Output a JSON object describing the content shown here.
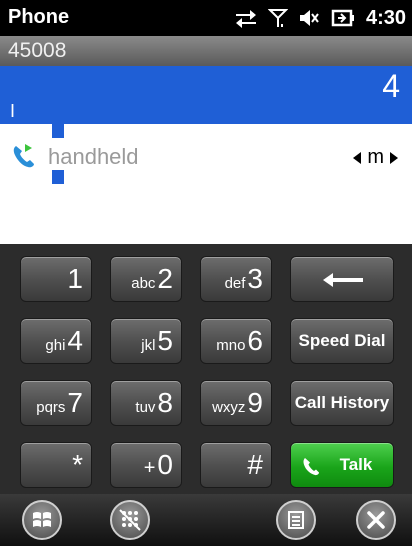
{
  "app_title": "Phone",
  "status": {
    "time": "4:30"
  },
  "carrier": "45008",
  "entry": {
    "number": "4",
    "cursor": "I"
  },
  "match": {
    "name": "handheld",
    "type": "m"
  },
  "keypad": {
    "k1": "1",
    "k2_letters": "abc",
    "k2": "2",
    "k3_letters": "def",
    "k3": "3",
    "k4_letters": "ghi",
    "k4": "4",
    "k5_letters": "jkl",
    "k5": "5",
    "k6_letters": "mno",
    "k6": "6",
    "k7_letters": "pqrs",
    "k7": "7",
    "k8_letters": "tuv",
    "k8": "8",
    "k9_letters": "wxyz",
    "k9": "9",
    "star": "*",
    "k0_prefix": "+",
    "k0": "0",
    "hash": "#",
    "speed_dial": "Speed Dial",
    "call_history": "Call History",
    "talk": "Talk"
  },
  "colors": {
    "selection": "#1f5fd6",
    "talk_green": "#1aa51a",
    "keypad_bg": "#2c2c2c"
  }
}
